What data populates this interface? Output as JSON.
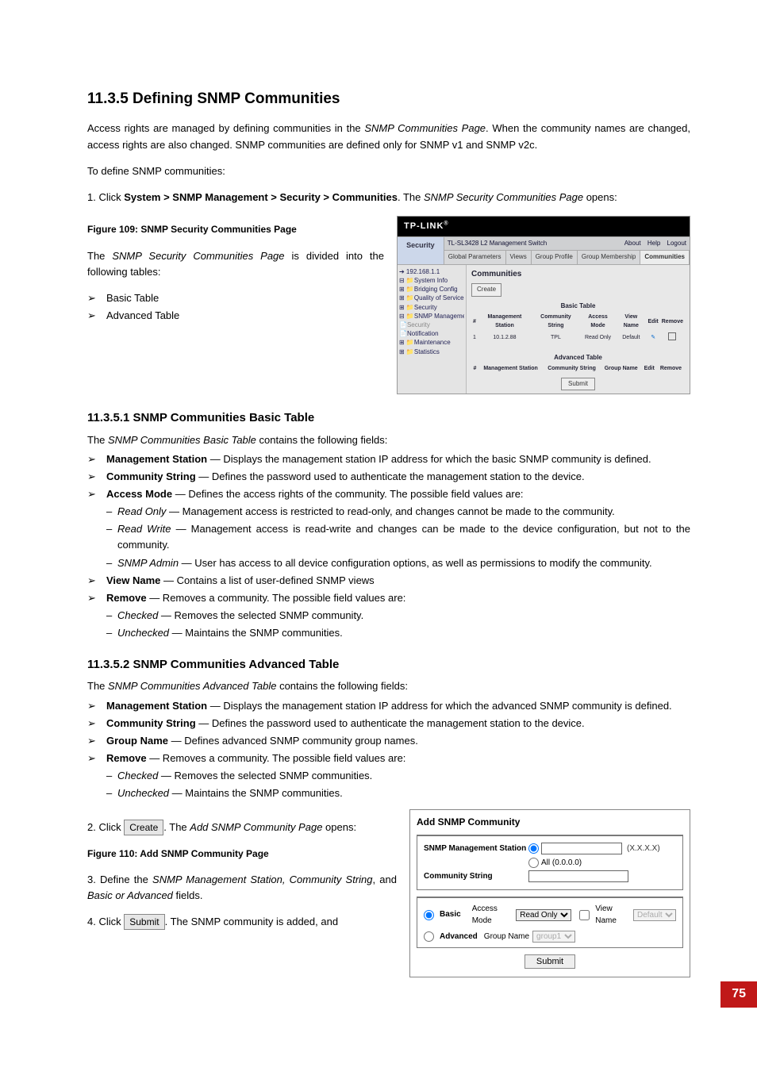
{
  "page_number": "75",
  "section": {
    "heading": "11.3.5  Defining SNMP Communities",
    "intro_1": "Access rights are managed by defining communities in the ",
    "intro_em": "SNMP Communities Page",
    "intro_2": ". When the community names are changed, access rights are also changed. SNMP communities are defined only for SNMP v1 and SNMP v2c.",
    "lead": "To define SNMP communities:",
    "step1_a": "1.   Click ",
    "step1_b": "System > SNMP Management > Security > Communities",
    "step1_c": ". The ",
    "step1_em": "SNMP Security Communities Page",
    "step1_d": " opens:",
    "fig109_caption": "Figure 109: SNMP Security Communities Page",
    "divided_a": "The ",
    "divided_em": "SNMP Security Communities Page",
    "divided_b": " is divided into the following tables:",
    "divided_items": [
      "Basic Table",
      "Advanced Table"
    ]
  },
  "fig109": {
    "brand": "TP-LINK",
    "nav_label": "Security",
    "breadcrumb": "TL-SL3428 L2 Management Switch",
    "links": [
      "About",
      "Help",
      "Logout"
    ],
    "tabs": [
      "Global Parameters",
      "Views",
      "Group Profile",
      "Group Membership",
      "Communities"
    ],
    "active_tab_index": 4,
    "tree": [
      "➔ 192.168.1.1",
      "⊟ 📁System Info",
      "⊞ 📁Bridging Config",
      "⊞ 📁Quality of Service",
      "⊞ 📁Security",
      "⊟ 📁SNMP Management",
      "   📄Security",
      "   📄Notification",
      "⊞ 📁Maintenance",
      "⊞ 📁Statistics"
    ],
    "main_title": "Communities",
    "create_label": "Create",
    "basic_title": "Basic Table",
    "basic_headers": [
      "#",
      "Management Station",
      "Community String",
      "Access Mode",
      "View Name",
      "Edit",
      "Remove"
    ],
    "basic_row": {
      "n": "1",
      "station": "10.1.2.88",
      "string": "TPL",
      "mode": "Read Only",
      "view": "Default"
    },
    "advanced_title": "Advanced Table",
    "advanced_headers": [
      "#",
      "Management Station",
      "Community String",
      "Group Name",
      "Edit",
      "Remove"
    ],
    "submit_label": "Submit"
  },
  "basic": {
    "heading": "11.3.5.1  SNMP Communities Basic Table",
    "lead_a": "The ",
    "lead_em": "SNMP Communities Basic Table",
    "lead_b": " contains the following fields:",
    "items": [
      {
        "term": "Management Station",
        "desc": " — Displays the management station IP address for which the basic SNMP community is defined."
      },
      {
        "term": "Community String",
        "desc": " — Defines the password used to authenticate the management station to the device."
      },
      {
        "term": "Access Mode",
        "desc": " — Defines the access rights of the community. The possible field values are:"
      },
      {
        "term": "View Name",
        "desc": " — Contains a list of user-defined SNMP views"
      },
      {
        "term": "Remove",
        "desc": " — Removes a community. The possible field values are:"
      }
    ],
    "access_sub": [
      {
        "em": "Read Only",
        "txt": " — Management access is restricted to read-only, and changes cannot be made to the community."
      },
      {
        "em": "Read Write",
        "txt": " — Management access is read-write and changes can be made to the device configuration, but not to the community."
      },
      {
        "em": "SNMP Admin",
        "txt": " — User has access to all device configuration options, as well as permissions to modify the community."
      }
    ],
    "remove_sub": [
      {
        "em": "Checked",
        "txt": " — Removes the selected SNMP community."
      },
      {
        "em": "Unchecked",
        "txt": " — Maintains the SNMP communities."
      }
    ]
  },
  "advanced": {
    "heading": "11.3.5.2  SNMP Communities Advanced Table",
    "lead_a": "The ",
    "lead_em": "SNMP Communities Advanced Table",
    "lead_b": " contains the following fields:",
    "items": [
      {
        "term": "Management Station",
        "desc": " — Displays the management station IP address for which the advanced SNMP community is defined."
      },
      {
        "term": "Community String",
        "desc": " — Defines the password used to authenticate the management station to the device."
      },
      {
        "term": "Group Name",
        "desc": " — Defines advanced SNMP community group names."
      },
      {
        "term": "Remove",
        "desc": " — Removes a community. The possible field values are:"
      }
    ],
    "remove_sub": [
      {
        "em": "Checked",
        "txt": " — Removes the selected SNMP communities."
      },
      {
        "em": "Unchecked",
        "txt": " — Maintains the SNMP communities."
      }
    ]
  },
  "steps_after": {
    "step2_a": "2.   Click ",
    "step2_btn": "Create",
    "step2_b": ". The ",
    "step2_em": "Add SNMP Community Page",
    "step2_c": " opens:",
    "fig110_caption": "Figure 110: Add SNMP Community Page",
    "step3_a": "3.    Define the ",
    "step3_em": "SNMP Management Station, Community String",
    "step3_b": ", and ",
    "step3_em2": "Basic or Advanced",
    "step3_c": " fields.",
    "step4_a": "4.   Click ",
    "step4_btn": "Submit",
    "step4_b": ". The SNMP community is added, and"
  },
  "fig110": {
    "title": "Add SNMP Community",
    "mgmt_label": "SNMP Management Station",
    "radio_all": "All (0.0.0.0)",
    "format_hint": "(X.X.X.X)",
    "comm_label": "Community String",
    "basic_label": "Basic",
    "access_mode_label": "Access Mode",
    "access_mode_value": "Read Only",
    "view_name_label": "View Name",
    "view_name_value": "Default",
    "advanced_label": "Advanced",
    "group_name_label": "Group Name",
    "group_name_value": "group1",
    "submit": "Submit"
  }
}
